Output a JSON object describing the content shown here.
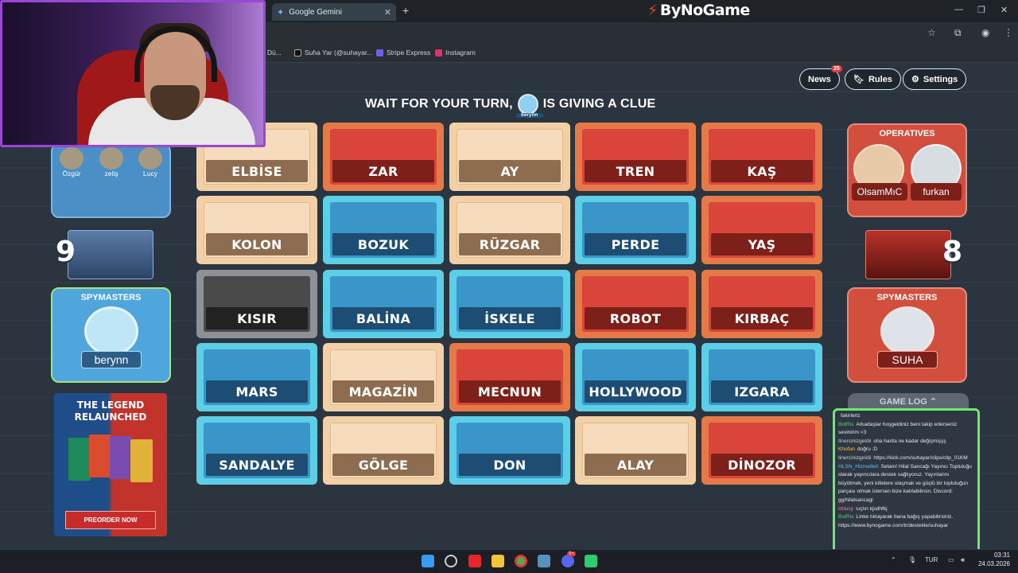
{
  "browser": {
    "tab_title": "Google Gemini",
    "new_tab": "+",
    "site_logo": "ByNoGame",
    "bookmarks": [
      {
        "label": "Dü..."
      },
      {
        "label": "Suha Yar (@suhayar..."
      },
      {
        "label": "Stripe Express"
      },
      {
        "label": "Instagram"
      }
    ]
  },
  "top_buttons": {
    "news": "News",
    "news_badge": "25",
    "rules": "Rules",
    "settings": "Settings"
  },
  "status": {
    "text_before": "WAIT FOR YOUR TURN,",
    "text_after": "IS GIVING A CLUE",
    "avatar_name": "berynn"
  },
  "board": {
    "cards": [
      {
        "word": "ELBİSE",
        "color": "neutral"
      },
      {
        "word": "ZAR",
        "color": "red"
      },
      {
        "word": "AY",
        "color": "neutral"
      },
      {
        "word": "TREN",
        "color": "red"
      },
      {
        "word": "KAŞ",
        "color": "red"
      },
      {
        "word": "KOLON",
        "color": "neutral"
      },
      {
        "word": "BOZUK",
        "color": "blue"
      },
      {
        "word": "RÜZGAR",
        "color": "neutral"
      },
      {
        "word": "PERDE",
        "color": "blue"
      },
      {
        "word": "YAŞ",
        "color": "red"
      },
      {
        "word": "KISIR",
        "color": "black"
      },
      {
        "word": "BALİNA",
        "color": "blue"
      },
      {
        "word": "İSKELE",
        "color": "blue"
      },
      {
        "word": "ROBOT",
        "color": "red"
      },
      {
        "word": "KIRBAÇ",
        "color": "red"
      },
      {
        "word": "MARS",
        "color": "blue"
      },
      {
        "word": "MAGAZİN",
        "color": "neutral"
      },
      {
        "word": "MECNUN",
        "color": "red"
      },
      {
        "word": "HOLLYWOOD",
        "color": "blue"
      },
      {
        "word": "IZGARA",
        "color": "blue"
      },
      {
        "word": "SANDALYE",
        "color": "blue"
      },
      {
        "word": "GÖLGE",
        "color": "neutral"
      },
      {
        "word": "DON",
        "color": "blue"
      },
      {
        "word": "ALAY",
        "color": "neutral"
      },
      {
        "word": "DİNOZOR",
        "color": "red"
      }
    ]
  },
  "blue_team": {
    "operatives": [
      "Özgür",
      "zeliş",
      "Lucy"
    ],
    "remaining": "9",
    "spymasters_title": "SPYMASTERS",
    "spymaster": "berynn"
  },
  "red_team": {
    "operatives_title": "OPERATIVES",
    "operatives": [
      "OlsamMıC",
      "furkan"
    ],
    "remaining": "8",
    "spymasters_title": "SPYMASTERS",
    "spymaster": "SUHA"
  },
  "promo": {
    "title_line1": "THE LEGEND",
    "title_line2": "RELAUNCHED",
    "button": "PREORDER NOW"
  },
  "game_log": {
    "title": "GAME LOG",
    "messages": [
      {
        "user": "",
        "text": "fakirleriz"
      },
      {
        "user": "BotRix",
        "text": "Arkadaşlar hoşgeldiniz beni takip ederseniz sevinirim <3"
      },
      {
        "user": "tinercinizgeldii",
        "text": "oha harita ne kadar değişmişşş"
      },
      {
        "user": "Khofun",
        "text": "doğru :D"
      },
      {
        "user": "tinercinizgeldii",
        "text": "https://kick.com/suhayar/clips/clip_01KM"
      },
      {
        "user": "HLSN_Hizmetleri",
        "text": "Selam! Hilal Sancağı Yayıncı Topluluğu olarak yayıncılara destek sağlıyoruz. Yayınlarını büyütmek, yeni kitlelere ulaşmak ve güçlü bir topluluğun parçası olmak istersen bize katılabilirsin. Discord: gg/hilalsancagi"
      },
      {
        "user": "ctrlucy",
        "text": "sıçtın kjsdhfkj"
      },
      {
        "user": "BotRix",
        "text": "Linke tıklayarak bana bağış yapabilirsiniz. https://www.bynogame.com/tr/destekle/suhayar"
      }
    ]
  },
  "taskbar": {
    "lang": "TUR",
    "time": "03:31",
    "date": "24.03.2026",
    "discord_badge": "9+"
  },
  "colors": {
    "red_team": "#d9453a",
    "blue_team": "#3a95c8",
    "neutral": "#f6dcbd",
    "assassin": "#4a4a4a",
    "chat_border": "#6ee86e",
    "cam_border": "#9b47d6"
  }
}
